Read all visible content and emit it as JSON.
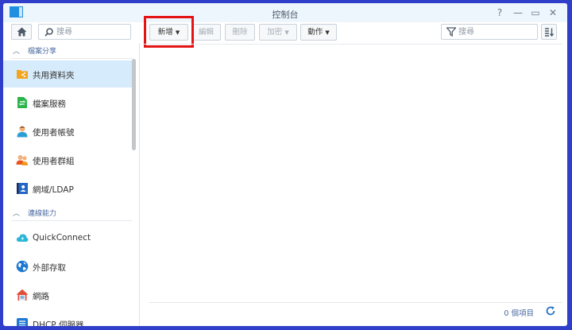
{
  "window": {
    "title": "控制台",
    "controls": {
      "help": "?",
      "minimize": "—",
      "maximize": "▭",
      "close": "✕"
    }
  },
  "sidebar": {
    "search_placeholder": "搜尋",
    "sections": [
      {
        "label": "檔案分享",
        "items": [
          {
            "label": "共用資料夾",
            "icon": "shared-folder-icon",
            "active": true
          },
          {
            "label": "檔案服務",
            "icon": "file-services-icon"
          },
          {
            "label": "使用者帳號",
            "icon": "user-icon"
          },
          {
            "label": "使用者群組",
            "icon": "group-icon"
          },
          {
            "label": "網域/LDAP",
            "icon": "domain-ldap-icon"
          }
        ]
      },
      {
        "label": "連線能力",
        "items": [
          {
            "label": "QuickConnect",
            "icon": "quickconnect-icon"
          },
          {
            "label": "外部存取",
            "icon": "external-access-icon"
          },
          {
            "label": "網路",
            "icon": "network-icon"
          },
          {
            "label": "DHCP 伺服器",
            "icon": "dhcp-server-icon"
          }
        ]
      }
    ]
  },
  "toolbar": {
    "create": "新增",
    "edit": "編輯",
    "delete": "刪除",
    "encrypt": "加密",
    "action": "動作",
    "search_placeholder": "搜尋"
  },
  "footer": {
    "item_count": "0 個項目"
  },
  "colors": {
    "accent": "#1f8fe0",
    "active_bg": "#d6ebfb",
    "highlight": "#e51414",
    "desktop": "#2f3fc9"
  }
}
